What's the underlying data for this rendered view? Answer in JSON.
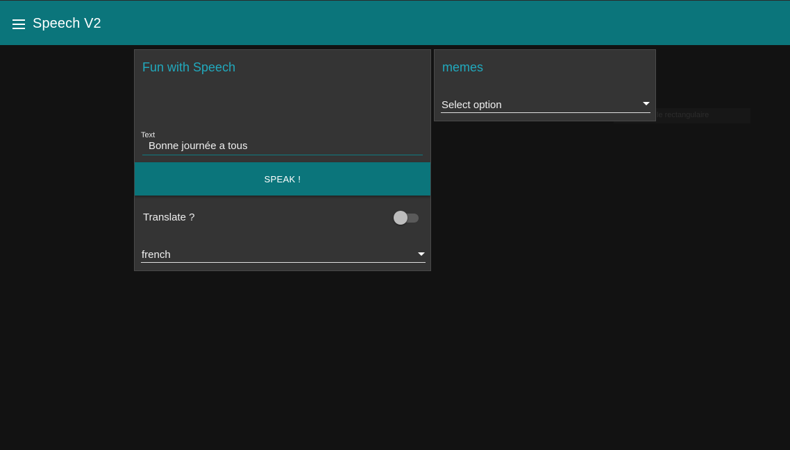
{
  "appbar": {
    "title": "Speech V2",
    "menu_icon": "hamburger-menu-icon",
    "color": "#0b757b"
  },
  "speech_card": {
    "title": "Fun with Speech",
    "text_field": {
      "label": "Text",
      "value": "Bonne journée a tous"
    },
    "speak_button_label": "SPEAK !",
    "translate": {
      "label": "Translate ?",
      "enabled": false
    },
    "language_select": {
      "value": "french"
    }
  },
  "meme_card": {
    "title": "memes",
    "select": {
      "value": "Select option"
    }
  },
  "overlay_hint": {
    "text": "le rectangulaire"
  },
  "colors": {
    "accent": "#21a9bd",
    "primary": "#0b757b",
    "card_bg": "#343434",
    "page_bg": "#121212"
  }
}
